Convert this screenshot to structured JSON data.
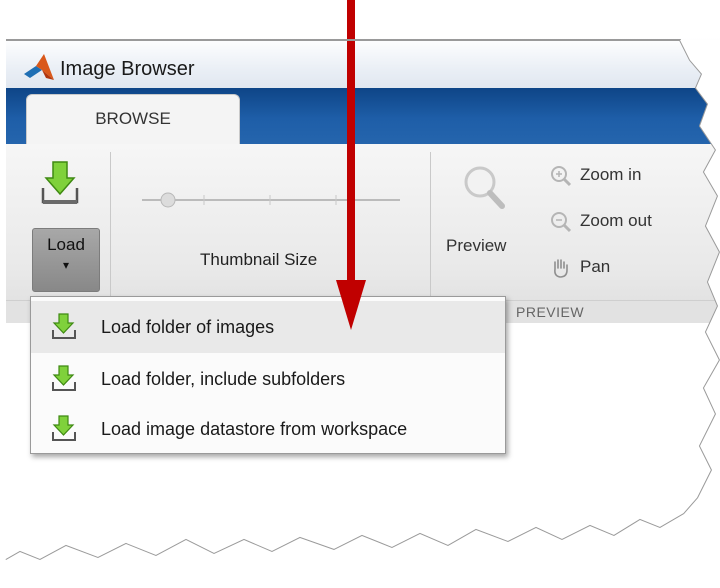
{
  "window": {
    "title": "Image Browser"
  },
  "tabs": [
    {
      "label": "BROWSE"
    }
  ],
  "toolstrip": {
    "load_label": "Load",
    "load_arrow": "▾",
    "thumbnail_label": "Thumbnail Size",
    "preview_label": "Preview",
    "zoom_in_label": "Zoom in",
    "zoom_out_label": "Zoom out",
    "pan_label": "Pan",
    "section_label": "PREVIEW"
  },
  "load_menu": {
    "items": [
      {
        "label": "Load folder of images",
        "icon": "download-icon"
      },
      {
        "label": "Load folder, include subfolders",
        "icon": "download-icon"
      },
      {
        "label": "Load image datastore from workspace",
        "icon": "download-icon"
      }
    ],
    "highlighted_index": 0
  },
  "colors": {
    "tabstrip": "#1e5ea8",
    "annotation_arrow": "#c00000",
    "icon_green": "#6cc22e"
  }
}
